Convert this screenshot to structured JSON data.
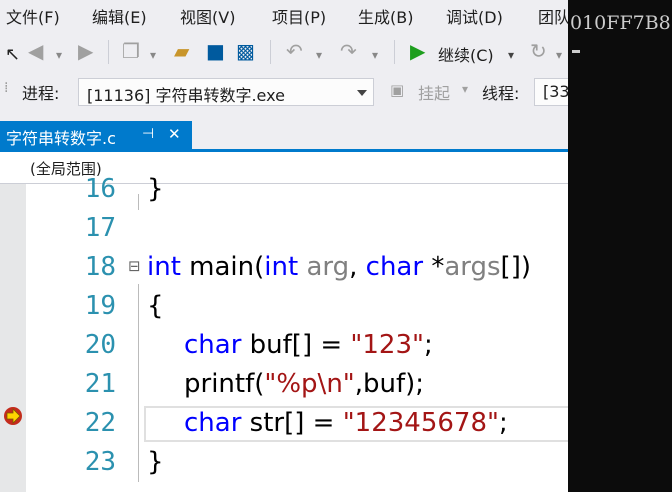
{
  "menu": [
    "文件(F)",
    "编辑(E)",
    "视图(V)",
    "项目(P)",
    "生成(B)",
    "调试(D)",
    "团队"
  ],
  "toolbar": {
    "continue_label": "继续(C)"
  },
  "process_bar": {
    "process_label": "进程:",
    "process_value": "[11136] 字符串转数字.exe",
    "suspend_label": "挂起",
    "thread_label": "线程:",
    "thread_value": "[33"
  },
  "tab": {
    "title": "字符串转数字.c",
    "pin_glyph": "⊣",
    "close_glyph": "✕"
  },
  "scope": {
    "label": "(全局范围)"
  },
  "editor": {
    "lines": [
      {
        "num": "16",
        "text": "}"
      },
      {
        "num": "17",
        "text": ""
      },
      {
        "num": "18",
        "kw1": "int",
        "fn": " main(",
        "kw2": "int",
        "p1": " arg",
        "comma": ", ",
        "kw3": "char",
        "star": " *",
        "p2": "args",
        "end": "[])"
      },
      {
        "num": "19",
        "text": "{"
      },
      {
        "num": "20",
        "kw": "char",
        "mid": " buf[] = ",
        "str": "\"123\"",
        "end": ";"
      },
      {
        "num": "21",
        "fn": "printf(",
        "str": "\"%p\\n\"",
        "end": ",buf);"
      },
      {
        "num": "22",
        "kw": "char",
        "mid": " str[] = ",
        "str": "\"12345678\"",
        "end": ";"
      },
      {
        "num": "23",
        "text": "}"
      }
    ],
    "collapse_glyph": "⊟"
  },
  "console": {
    "output": "010FF7B8"
  },
  "colors": {
    "accent": "#007acc",
    "keyword": "#0000ff",
    "string": "#a31515",
    "line_number": "#2b91af",
    "param": "#808080"
  }
}
